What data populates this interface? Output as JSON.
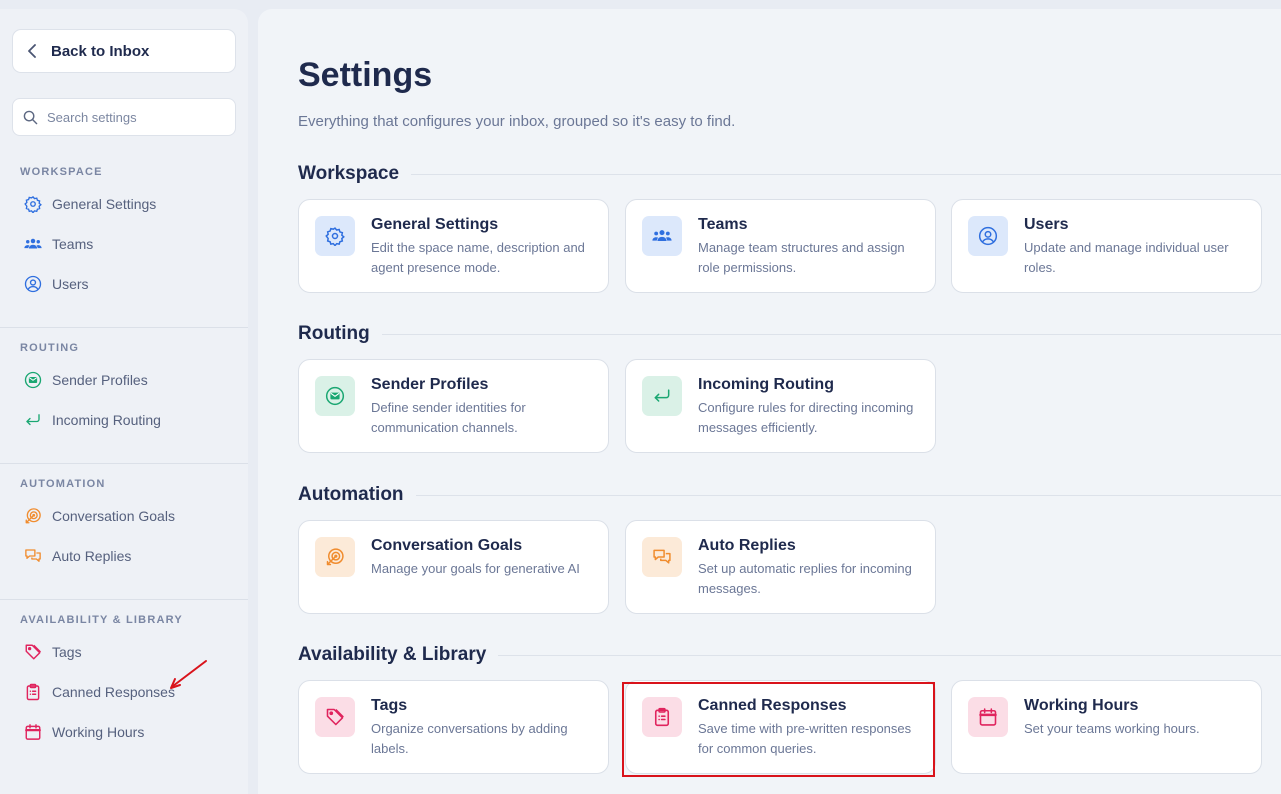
{
  "sidebar": {
    "back_label": "Back to Inbox",
    "search_placeholder": "Search settings",
    "sections": [
      {
        "heading": "WORKSPACE",
        "items": [
          {
            "label": "General Settings",
            "icon": "gear-icon",
            "color": "#2f6fdf"
          },
          {
            "label": "Teams",
            "icon": "team-icon",
            "color": "#2f6fdf"
          },
          {
            "label": "Users",
            "icon": "user-circle-icon",
            "color": "#2f6fdf"
          }
        ]
      },
      {
        "heading": "ROUTING",
        "items": [
          {
            "label": "Sender Profiles",
            "icon": "mail-badge-icon",
            "color": "#1aa772"
          },
          {
            "label": "Incoming Routing",
            "icon": "return-arrow-icon",
            "color": "#1aa772"
          }
        ]
      },
      {
        "heading": "AUTOMATION",
        "items": [
          {
            "label": "Conversation Goals",
            "icon": "target-icon",
            "color": "#f08c2e"
          },
          {
            "label": "Auto Replies",
            "icon": "chat-bubbles-icon",
            "color": "#f08c2e"
          }
        ]
      },
      {
        "heading": "AVAILABILITY & LIBRARY",
        "items": [
          {
            "label": "Tags",
            "icon": "tag-icon",
            "color": "#e0245e"
          },
          {
            "label": "Canned Responses",
            "icon": "clipboard-icon",
            "color": "#e0245e"
          },
          {
            "label": "Working Hours",
            "icon": "calendar-icon",
            "color": "#e0245e"
          }
        ]
      }
    ]
  },
  "main": {
    "title": "Settings",
    "subtitle": "Everything that configures your inbox, grouped so it's easy to find.",
    "groups": [
      {
        "title": "Workspace",
        "cards": [
          {
            "title": "General Settings",
            "desc": "Edit the space name, description and agent presence mode.",
            "icon": "gear-icon"
          },
          {
            "title": "Teams",
            "desc": "Manage team structures and assign role permissions.",
            "icon": "team-icon"
          },
          {
            "title": "Users",
            "desc": "Update and manage individual user roles.",
            "icon": "user-circle-icon"
          }
        ]
      },
      {
        "title": "Routing",
        "cards": [
          {
            "title": "Sender Profiles",
            "desc": "Define sender identities for communication channels.",
            "icon": "mail-badge-icon"
          },
          {
            "title": "Incoming Routing",
            "desc": "Configure rules for directing incoming messages efficiently.",
            "icon": "return-arrow-icon"
          }
        ]
      },
      {
        "title": "Automation",
        "cards": [
          {
            "title": "Conversation Goals",
            "desc": "Manage your goals for generative AI",
            "icon": "target-icon"
          },
          {
            "title": "Auto Replies",
            "desc": "Set up automatic replies for incoming messages.",
            "icon": "chat-bubbles-icon"
          }
        ]
      },
      {
        "title": "Availability & Library",
        "cards": [
          {
            "title": "Tags",
            "desc": "Organize conversations by adding labels.",
            "icon": "tag-icon"
          },
          {
            "title": "Canned Responses",
            "desc": "Save time with pre-written responses for common queries.",
            "icon": "clipboard-icon"
          },
          {
            "title": "Working Hours",
            "desc": "Set your teams working hours.",
            "icon": "calendar-icon"
          }
        ]
      }
    ]
  },
  "colors": {
    "blue": "#2f6fdf",
    "green": "#1aa772",
    "orange": "#f08c2e",
    "pink": "#e0245e",
    "annotation": "#d9131b"
  }
}
